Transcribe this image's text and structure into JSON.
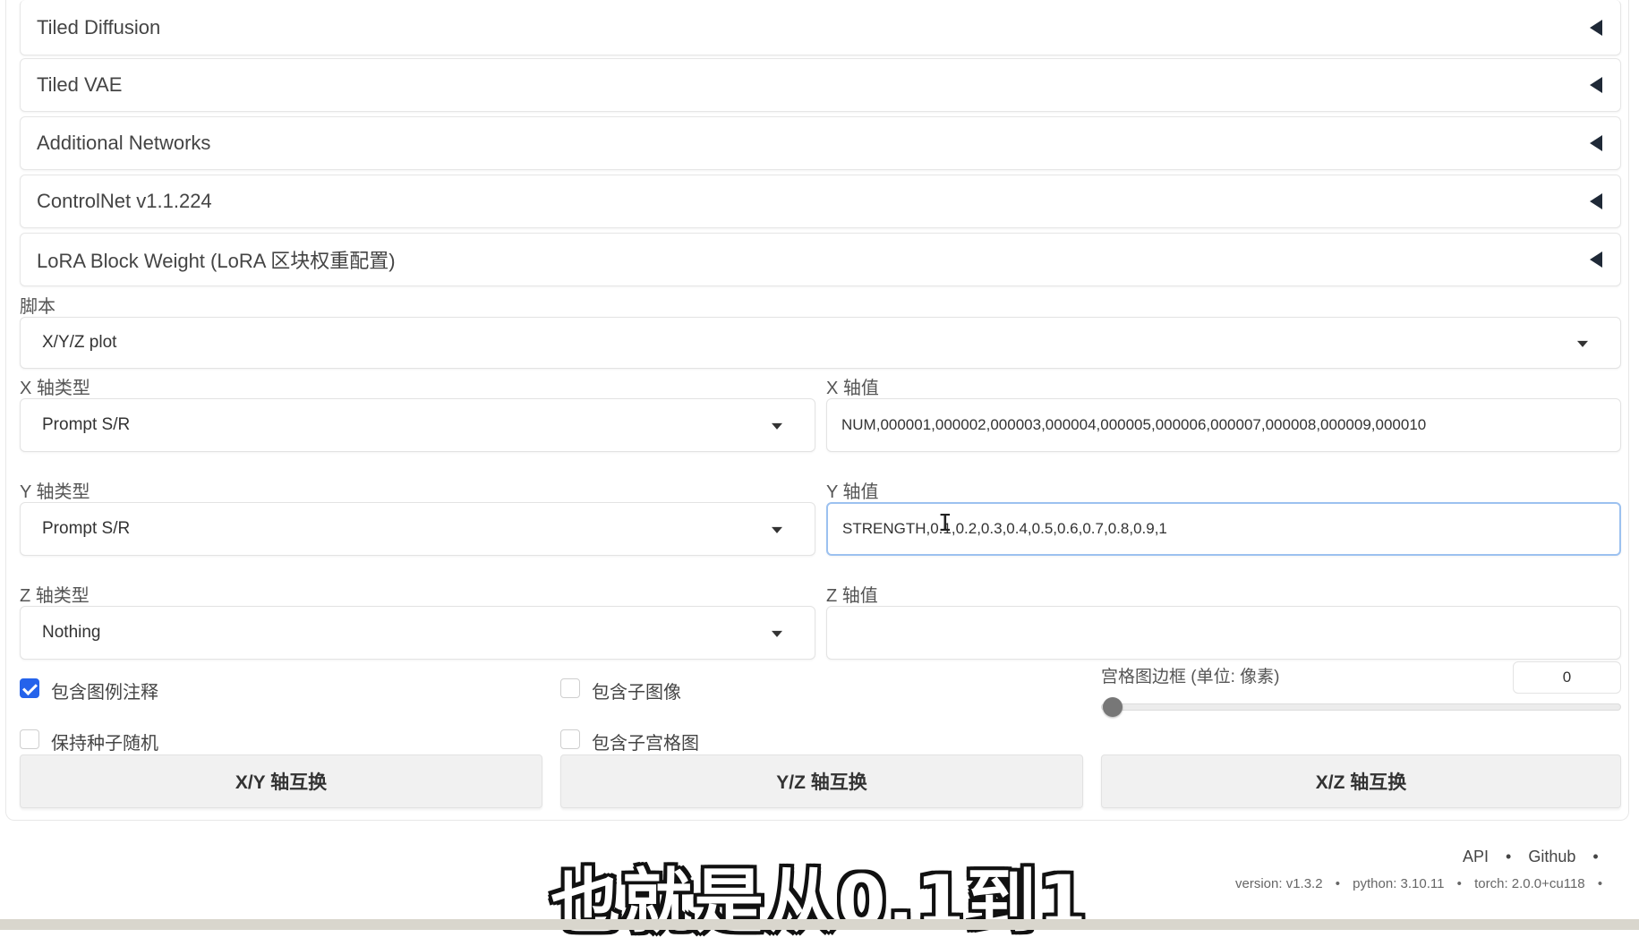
{
  "accordions": [
    {
      "label": "Tiled Diffusion"
    },
    {
      "label": "Tiled VAE"
    },
    {
      "label": "Additional Networks"
    },
    {
      "label": "ControlNet v1.1.224"
    },
    {
      "label": "LoRA Block Weight (LoRA 区块权重配置)"
    }
  ],
  "script": {
    "label": "脚本",
    "value": "X/Y/Z plot"
  },
  "axes": {
    "x_type_label": "X 轴类型",
    "x_type_value": "Prompt S/R",
    "x_values_label": "X 轴值",
    "x_values_value": "NUM,000001,000002,000003,000004,000005,000006,000007,000008,000009,000010",
    "y_type_label": "Y 轴类型",
    "y_type_value": "Prompt S/R",
    "y_values_label": "Y 轴值",
    "y_values_value": "STRENGTH,0.1,0.2,0.3,0.4,0.5,0.6,0.7,0.8,0.9,1",
    "z_type_label": "Z 轴类型",
    "z_type_value": "Nothing",
    "z_values_label": "Z 轴值",
    "z_values_value": ""
  },
  "options": {
    "include_legend_label": "包含图例注释",
    "include_legend_checked": true,
    "include_sub_images_label": "包含子图像",
    "include_sub_images_checked": false,
    "keep_seed_random_label": "保持种子随机",
    "keep_seed_random_checked": false,
    "include_sub_grids_label": "包含子宫格图",
    "include_sub_grids_checked": false,
    "grid_margin_label": "宫格图边框 (单位: 像素)",
    "grid_margin_value": "0",
    "grid_margin_fraction": 0
  },
  "buttons": {
    "swap_xy": "X/Y 轴互换",
    "swap_yz": "Y/Z 轴互换",
    "swap_xz": "X/Z 轴互换"
  },
  "footer": {
    "api": "API",
    "github": "Github",
    "version": "version: v1.3.2",
    "python": "python: 3.10.11",
    "torch": "torch: 2.0.0+cu118",
    "sep": "•"
  },
  "subtitle": "也就是从0.1到1",
  "colors": {
    "checkbox_accent": "#2563eb",
    "subtitle_fill": "#ffffff",
    "subtitle_outline": "#111111"
  }
}
